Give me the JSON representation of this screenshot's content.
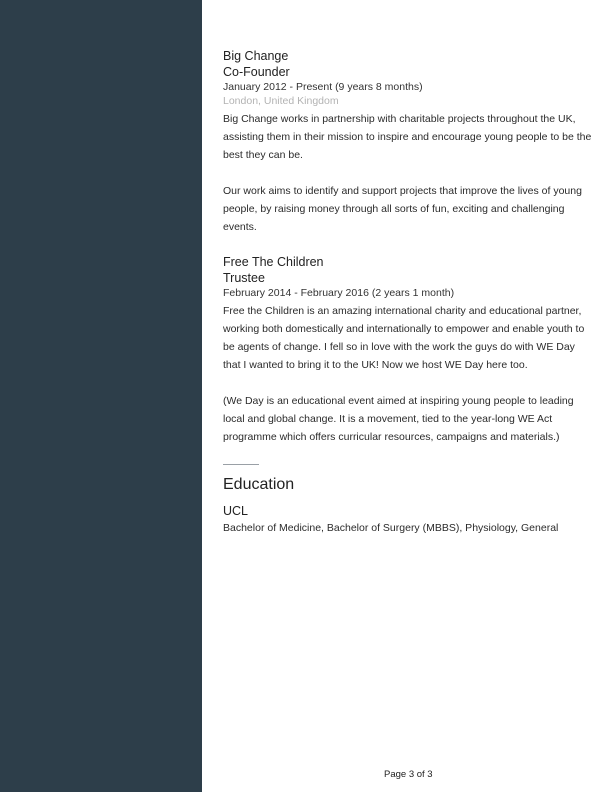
{
  "experience": [
    {
      "company": "Big Change",
      "role": "Co-Founder",
      "dates": "January 2012 - Present (9 years 8 months)",
      "location": "London, United Kingdom",
      "paragraphs": [
        "Big Change works in partnership with charitable projects throughout the UK, assisting them in their mission to inspire and encourage young people to be the best they can be.",
        "Our work aims to identify and support projects that improve the lives of young people, by raising money through all sorts of fun, exciting and challenging events."
      ]
    },
    {
      "company": "Free The Children",
      "role": "Trustee",
      "dates": "February 2014 - February 2016 (2 years 1 month)",
      "paragraphs": [
        "Free the Children is an amazing international charity and educational partner, working both domestically and internationally to empower and enable youth to be agents of change. I fell so in love with the work the guys do with WE Day that I wanted to bring it to the UK! Now we host WE Day here too.",
        "(We Day is an educational event aimed at inspiring young people to leading local and global change. It is a movement, tied to the year-long WE Act programme which offers curricular resources, campaigns and materials.)"
      ]
    }
  ],
  "education": {
    "title": "Education",
    "school": "UCL",
    "degree": "Bachelor of Medicine, Bachelor of Surgery (MBBS), Physiology, General"
  },
  "footer": {
    "page_label": "Page 3 of 3"
  },
  "colors": {
    "sidebar": "#2d3e4a",
    "location": "#b3b3b3"
  }
}
